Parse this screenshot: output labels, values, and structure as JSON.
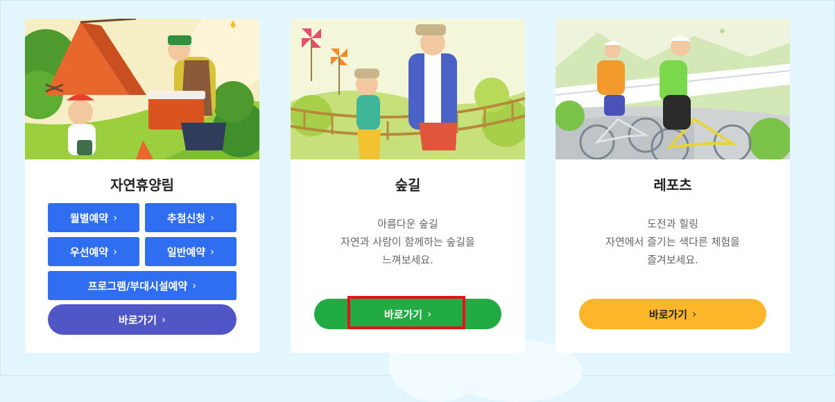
{
  "cards": [
    {
      "title": "자연휴양림",
      "buttons": [
        {
          "label": "월별예약",
          "chevron": "›"
        },
        {
          "label": "추첨신청",
          "chevron": "›"
        },
        {
          "label": "우선예약",
          "chevron": "›"
        },
        {
          "label": "일반예약",
          "chevron": "›"
        },
        {
          "label": "프로그램/부대시설예약",
          "chevron": "›"
        }
      ],
      "go_label": "바로가기",
      "go_chevron": "›",
      "go_color": "#5156c6"
    },
    {
      "title": "숲길",
      "description": [
        "아름다운 숲길",
        "자연과 사람이 함께하는 숲길을",
        "느껴보세요."
      ],
      "go_label": "바로가기",
      "go_chevron": "›",
      "go_color": "#22ab43"
    },
    {
      "title": "레포츠",
      "description": [
        "도전과 힐링",
        "자연에서 즐기는 색다른 체험을",
        "즐겨보세요."
      ],
      "go_label": "바로가기",
      "go_chevron": "›",
      "go_color": "#fdb62a"
    }
  ],
  "colors": {
    "background": "#e3f5fd",
    "reservation_button": "#2f6ef0",
    "highlight_box": "#e8101a"
  },
  "icons": [
    "chevron-right-icon"
  ]
}
